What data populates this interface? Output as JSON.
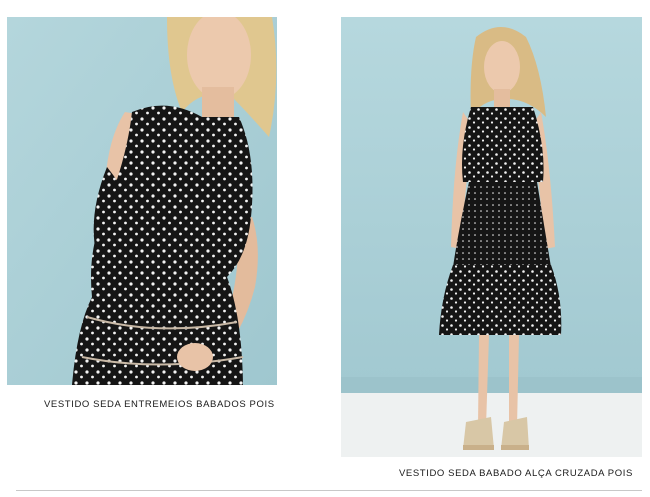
{
  "products": [
    {
      "caption": "VESTIDO SEDA ENTREMEIOS BABADOS POIS"
    },
    {
      "caption": "VESTIDO SEDA BABADO ALÇA CRUZADA POIS"
    }
  ],
  "colors": {
    "background_teal": "#a9cfd6",
    "floor_white": "#eef1f1",
    "dress_black": "#151515",
    "dot_white": "#f4f4f4",
    "skin": "#e8c3a7",
    "hair_blonde": "#e0c78f"
  }
}
